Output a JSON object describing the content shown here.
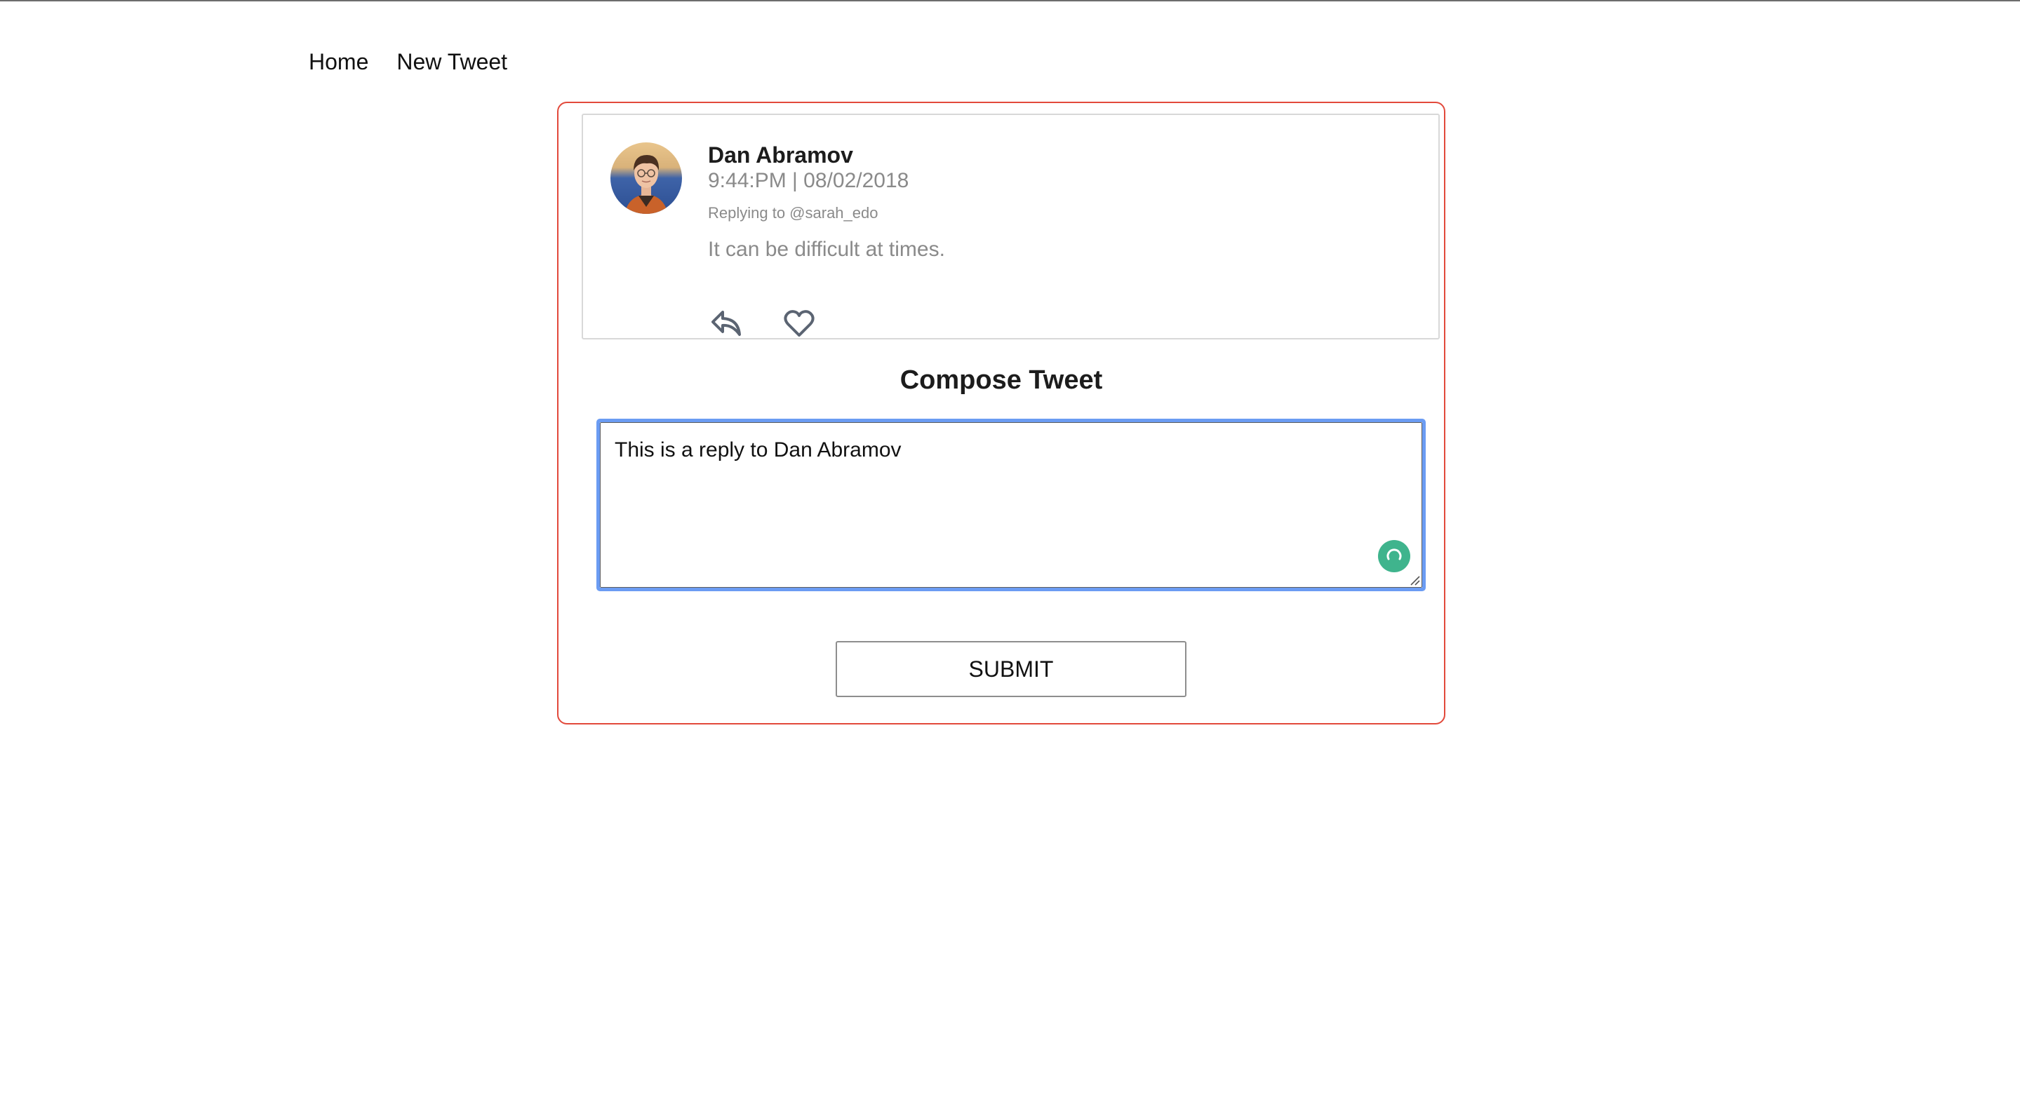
{
  "nav": {
    "home_label": "Home",
    "new_tweet_label": "New Tweet"
  },
  "tweet": {
    "author": "Dan Abramov",
    "timestamp": "9:44:PM | 08/02/2018",
    "replying_to": "Replying to @sarah_edo",
    "text": "It can be difficult at times.",
    "icons": {
      "reply": "reply-arrow-icon",
      "like": "heart-outline-icon"
    }
  },
  "compose": {
    "heading": "Compose Tweet",
    "value": "This is a reply to Dan Abramov",
    "submit_label": "SUBMIT"
  },
  "colors": {
    "container_border": "#e2493b",
    "focus_ring": "#6b9cf3",
    "grammar_badge": "#3fb48d",
    "muted_text": "#8a8a8a"
  }
}
